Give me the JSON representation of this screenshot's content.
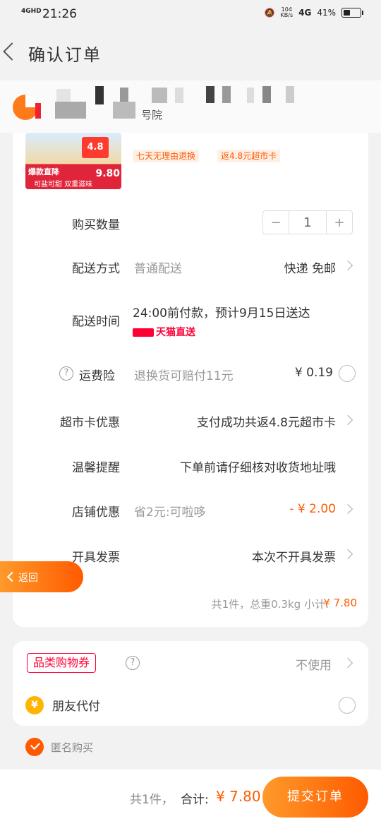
{
  "status_bar": {
    "network": "4GHD",
    "time": "21:26",
    "speed_value": "104",
    "speed_unit": "KB/s",
    "net2": "4G",
    "battery": "41%"
  },
  "header": {
    "title": "确认订单"
  },
  "store": {
    "name_fragment": "号院"
  },
  "product": {
    "tags": [
      "七天无理由退换",
      "返4.8元超市卡"
    ],
    "img_badge": "4.8",
    "img_deal": "爆款直降",
    "img_sub": "可盐可甜 双重滋味",
    "img_price": "9.80"
  },
  "quantity": {
    "label": "购买数量",
    "minus": "−",
    "value": "1",
    "plus": "+"
  },
  "delivery": {
    "label": "配送方式",
    "value": "普通配送",
    "right": "快递 免邮"
  },
  "delivery_time": {
    "label": "配送时间",
    "value": "24:00前付款，预计9月15日送达",
    "brand": "天猫直送"
  },
  "shipping_insurance": {
    "label": "运费险",
    "value": "退换货可赔付11元",
    "price": "¥ 0.19"
  },
  "market_card": {
    "label": "超市卡优惠",
    "value": "支付成功共返4.8元超市卡"
  },
  "reminder": {
    "label": "温馨提醒",
    "value": "下单前请仔细核对收货地址哦"
  },
  "store_discount": {
    "label": "店铺优惠",
    "value": "省2元:可啦哆",
    "price": "- ¥ 2.00"
  },
  "invoice": {
    "label": "开具发票",
    "value": "本次不开具发票"
  },
  "summary": {
    "text": "共1件，总重0.3kg 小计:",
    "price": "¥ 7.80"
  },
  "float_back": {
    "label": "返回"
  },
  "coupon": {
    "label": "品类购物券",
    "value": "不使用"
  },
  "friend_pay": {
    "label": "朋友代付",
    "icon": "¥"
  },
  "anonymous": {
    "label": "匿名购买"
  },
  "bottom": {
    "count": "共1件，",
    "total_label": "合计:",
    "total": "¥ 7.80",
    "submit": "提交订单"
  },
  "colors": {
    "accent": "#ff5a00",
    "tmall": "#ff0036"
  }
}
